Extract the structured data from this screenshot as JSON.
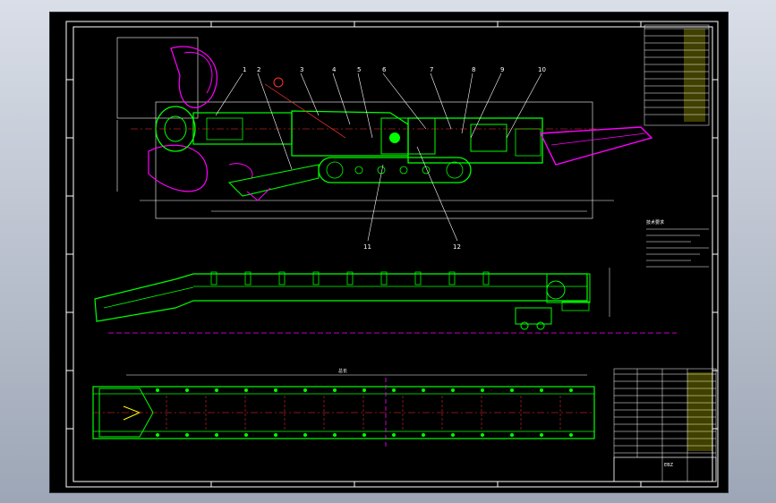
{
  "drawing": {
    "colors": {
      "background": "#000000",
      "frame": "#ffffff",
      "main": "#00ff00",
      "center_line": "#ff3333",
      "accent": "#ff00ff",
      "dimension": "#ffffff",
      "note": "#ffffff",
      "cyan": "#00ffff",
      "table_fill": "#ffff00"
    },
    "balloons_upper": [
      "1",
      "2",
      "3",
      "4",
      "5",
      "6",
      "7",
      "8",
      "9",
      "10"
    ],
    "balloons_lower": [
      "11",
      "12"
    ],
    "title_block_label": "EBZ",
    "notes_heading": "技术要求",
    "dimension_top_label": "总长"
  }
}
